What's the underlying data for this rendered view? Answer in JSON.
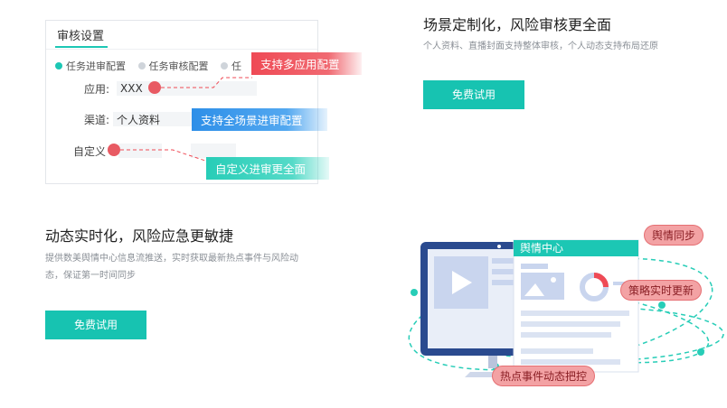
{
  "config_card": {
    "title": "审核设置",
    "tabs": [
      {
        "label": "任务进审配置",
        "active": true
      },
      {
        "label": "任务审核配置",
        "active": false
      },
      {
        "label": "任",
        "active": false
      }
    ],
    "rows": {
      "app": {
        "label": "应用:",
        "value": "XXX"
      },
      "channel": {
        "label": "渠道:",
        "value": "个人资料"
      },
      "custom": {
        "label": "自定义",
        "value": ""
      }
    },
    "callouts": {
      "multi_app": "支持多应用配置",
      "all_scene": "支持全场景进审配置",
      "custom": "自定义进审更全面"
    }
  },
  "feature_scene": {
    "title": "场景定制化，风险审核更全面",
    "description": "个人资料、直播封面支持整体审核，个人动态支持布局还原",
    "button": "免费试用"
  },
  "feature_realtime": {
    "title": "动态实时化，风险应急更敏捷",
    "description_line1": "提供数美舆情中心信息流推送，实时获取最新热点事件与风险动",
    "description_line2": "态，保证第一时间同步",
    "button": "免费试用"
  },
  "illustration": {
    "panel_title": "舆情中心",
    "badges": {
      "sync": "舆情同步",
      "strategy": "策略实时更新",
      "hotspot": "热点事件动态把控"
    }
  },
  "colors": {
    "accent": "#17c3b1",
    "red": "#ef4a55",
    "blue": "#2e8fe8",
    "green": "#27cdb7"
  }
}
